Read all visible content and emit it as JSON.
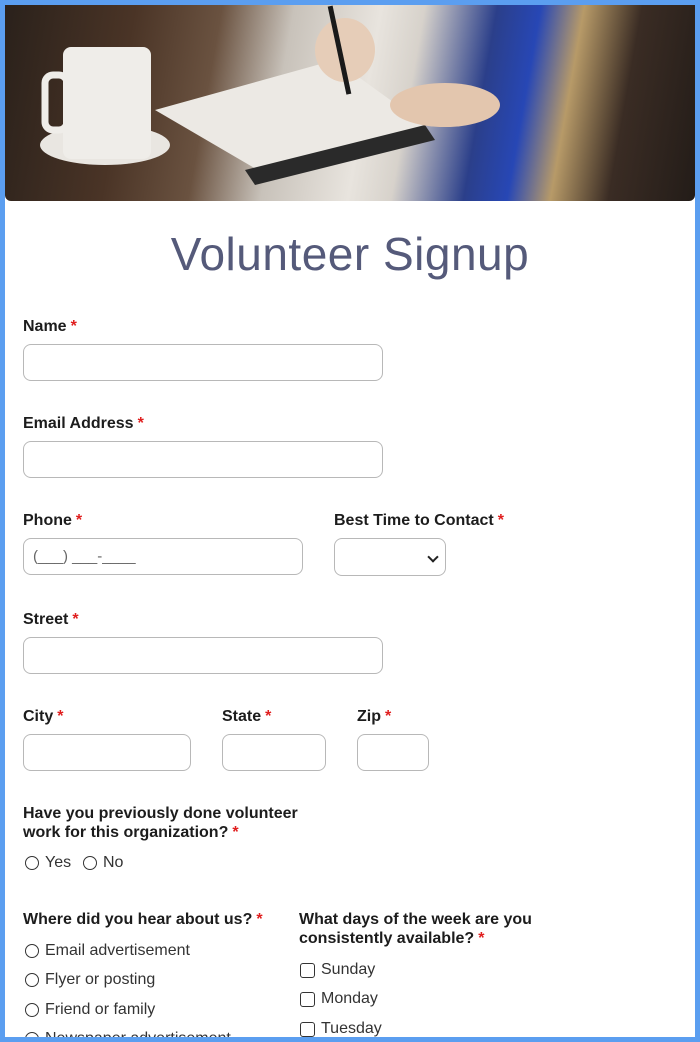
{
  "hero": {
    "image_alt": "People writing in notebooks at a table with a coffee mug"
  },
  "title": "Volunteer Signup",
  "required_marker": "*",
  "fields": {
    "name": {
      "label": "Name",
      "value": ""
    },
    "email": {
      "label": "Email Address",
      "value": ""
    },
    "phone": {
      "label": "Phone",
      "placeholder": "(___) ___-____",
      "value": ""
    },
    "best_time": {
      "label": "Best Time to Contact",
      "selected": ""
    },
    "street": {
      "label": "Street",
      "value": ""
    },
    "city": {
      "label": "City",
      "value": ""
    },
    "state": {
      "label": "State",
      "value": ""
    },
    "zip": {
      "label": "Zip",
      "value": ""
    }
  },
  "previous_volunteer": {
    "label_line1": "Have you previously done volunteer",
    "label_line2": "work for this organization?",
    "options": [
      "Yes",
      "No"
    ]
  },
  "heard_about": {
    "label": "Where did you hear about us?",
    "options": [
      "Email advertisement",
      "Flyer or posting",
      "Friend or family",
      "Newspaper advertisement"
    ]
  },
  "availability": {
    "label_line1": "What days of the week are you",
    "label_line2": "consistently available?",
    "options": [
      "Sunday",
      "Monday",
      "Tuesday"
    ]
  }
}
